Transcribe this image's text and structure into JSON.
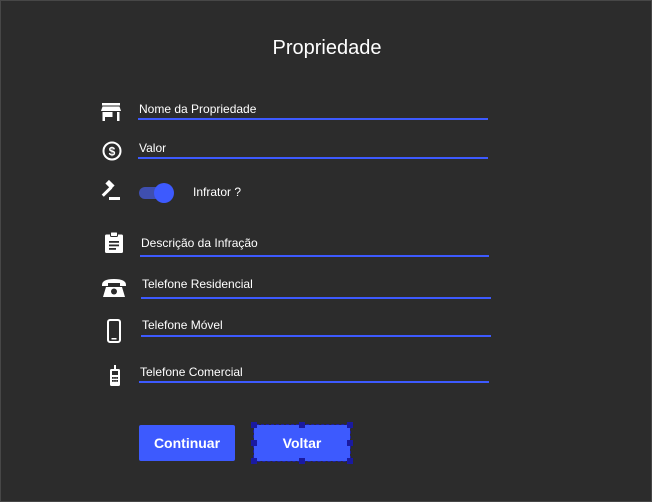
{
  "title": "Propriedade",
  "fields": {
    "name": {
      "label": "Nome da Propriedade",
      "icon": "store-icon"
    },
    "value": {
      "label": "Valor",
      "icon": "dollar-circle-icon"
    },
    "offender": {
      "label": "Infrator ?",
      "icon": "gavel-icon",
      "checked": true
    },
    "infraction": {
      "label": "Descrição da Infração",
      "icon": "clipboard-icon"
    },
    "home_phone": {
      "label": "Telefone Residencial",
      "icon": "telephone-icon"
    },
    "mobile_phone": {
      "label": "Telefone Móvel",
      "icon": "smartphone-icon"
    },
    "work_phone": {
      "label": "Telefone Comercial",
      "icon": "cellphone-icon"
    }
  },
  "buttons": {
    "continue": "Continuar",
    "back": "Voltar"
  },
  "colors": {
    "background": "#2c2c2c",
    "accent": "#3d5afe",
    "text": "#ffffff",
    "selection": "#1a1aa0"
  }
}
